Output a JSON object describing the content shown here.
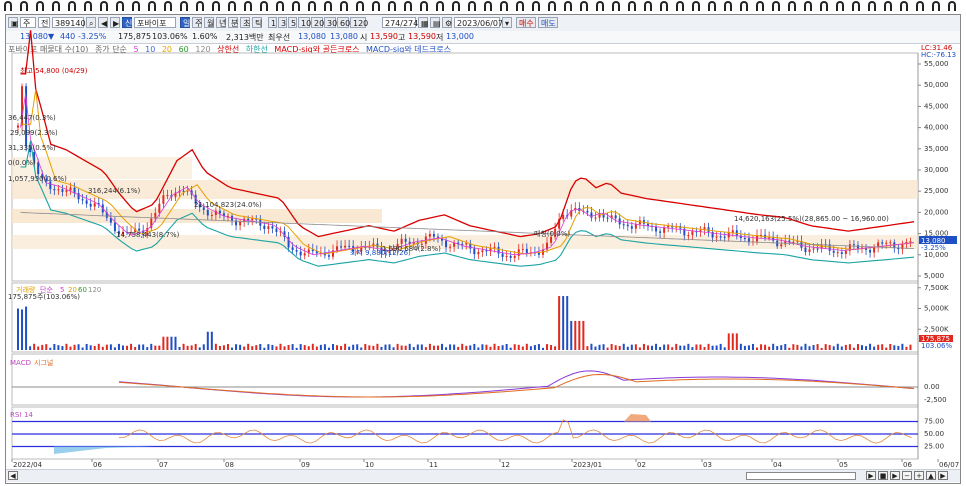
{
  "toolbar": {
    "period_label": "주",
    "period2_label": "전",
    "code": "389140",
    "name": "포바이포",
    "name_badge": "신",
    "period_buttons": [
      "일",
      "주",
      "월",
      "년",
      "분",
      "초",
      "틱"
    ],
    "interval_buttons": [
      "1",
      "3",
      "5",
      "10",
      "20",
      "30",
      "60",
      "120"
    ],
    "count": "274/274",
    "date": "2023/06/07",
    "buy_label": "매수",
    "sell_label": "매도"
  },
  "quote": {
    "price": "13,080",
    "change": "440",
    "change_pct": "-3.25%",
    "volume": "175,875",
    "volume_pct": "103.06%",
    "turnover": "1.60%",
    "amount": "2,313백만",
    "best_label": "최우선",
    "best": "13,080",
    "best2": "13,080",
    "open_label": "시",
    "open": "13,590",
    "high_label": "고",
    "high": "13,590",
    "low_label": "저",
    "low": "13,000"
  },
  "legend": {
    "title": "포바이포 매물대 수(10)",
    "ma_label": "종가 단순",
    "ma5": "5",
    "ma10": "10",
    "ma20": "20",
    "ma60": "60",
    "ma120": "120",
    "upper": "상한선",
    "lower": "하한선",
    "golden": "MACD-sig와 골든크로스",
    "dead": "MACD-sig와 데드크로스"
  },
  "annotations": {
    "high_marker": "최고 54,800 (04/29)",
    "low_marker": "최저 9,880(12/26)",
    "a1": "36,447(0.3%)",
    "a2": "29,099(2.3%)",
    "a3": "31,335(0.5%)",
    "a4": "0(0.0%)",
    "a5": "1,057,950(0.6%)",
    "a6": "316,244(6.1%)",
    "a7": "14,758,443(8.7%)",
    "a8": "21,104,823(24.0%)",
    "a9": "매칭(0.0%)",
    "a10": "1,690,684(2.8%)",
    "a11": "14,620,163(25.5%)(28,865.00 ~ 16,960.00)",
    "price_tag": "13,080",
    "price_pct": "-3.25%",
    "lc": "LC:31.46",
    "hc": "HC:-76.13"
  },
  "price_axis": [
    "55,000",
    "50,000",
    "45,000",
    "40,000",
    "35,000",
    "30,000",
    "25,000",
    "20,000",
    "15,000",
    "10,000",
    "5,000"
  ],
  "volume_panel": {
    "title": "거래량",
    "ma_label": "단순",
    "ma5": "5",
    "ma20": "20",
    "ma60": "60",
    "ma120": "120",
    "value": "175,875주(103.06%)",
    "axis": [
      "7,500K",
      "5,000K",
      "2,500K"
    ],
    "tag": "175,875",
    "tag_pct": "103.06%"
  },
  "macd_panel": {
    "title": "MACD",
    "signal": "시그널",
    "axis": [
      "0.00",
      "-2,500"
    ]
  },
  "rsi_panel": {
    "title": "RSI",
    "period": "14",
    "axis": [
      "75.00",
      "50.00",
      "25.00"
    ]
  },
  "time_axis": [
    "2022/04",
    "06",
    "07",
    "08",
    "09",
    "10",
    "11",
    "12",
    "2023/01",
    "02",
    "03",
    "04",
    "05",
    "06",
    "06/07"
  ],
  "colors": {
    "up": "#e12a1f",
    "down": "#1f4fc4",
    "upper_band": "#d90000",
    "lower_band": "#1aa3a3",
    "ma20": "#e6a000",
    "ma60": "#8c8c8c",
    "zone": "#f7e3c8",
    "rsi": "#2a2fe0"
  }
}
